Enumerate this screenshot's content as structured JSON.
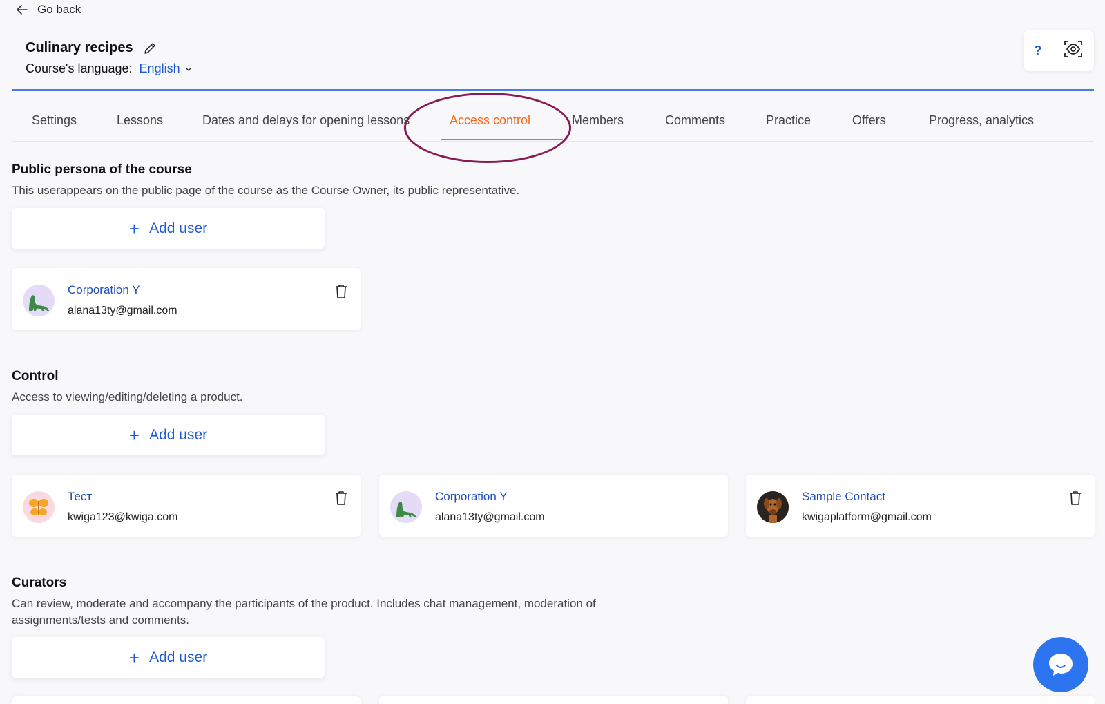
{
  "nav": {
    "go_back": "Go back"
  },
  "course": {
    "title": "Culinary recipes",
    "language_label": "Course's language:",
    "language_value": "English"
  },
  "top_actions": {
    "help": "?"
  },
  "tabs": [
    {
      "label": "Settings"
    },
    {
      "label": "Lessons"
    },
    {
      "label": "Dates and delays for opening lessons"
    },
    {
      "label": "Access control",
      "active": true
    },
    {
      "label": "Members"
    },
    {
      "label": "Comments"
    },
    {
      "label": "Practice"
    },
    {
      "label": "Offers"
    },
    {
      "label": "Progress, analytics"
    }
  ],
  "sections": {
    "public_persona": {
      "title": "Public persona of the course",
      "description": "This userappears on the public page of the course as the Course Owner, its public representative.",
      "add_label": "Add user",
      "users": [
        {
          "name": "Corporation Y",
          "email": "alana13ty@gmail.com",
          "avatar": "dinosaur-avatar"
        }
      ]
    },
    "control": {
      "title": "Control",
      "description": "Access to viewing/editing/deleting a product.",
      "add_label": "Add user",
      "users": [
        {
          "name": "Тест",
          "email": "kwiga123@kwiga.com",
          "avatar": "butterfly-avatar"
        },
        {
          "name": "Corporation Y",
          "email": "alana13ty@gmail.com",
          "avatar": "dinosaur-avatar"
        },
        {
          "name": "Sample Contact",
          "email": "kwigaplatform@gmail.com",
          "avatar": "dog-avatar"
        }
      ]
    },
    "curators": {
      "title": "Curators",
      "description": "Can review, moderate and accompany the participants of the product. Includes chat management, moderation of assignments/tests and comments.",
      "add_label": "Add user"
    }
  },
  "colors": {
    "accent_blue": "#1f5bd8",
    "active_tab": "#f26b1d",
    "highlight_ellipse": "#8c1a52",
    "chat_button": "#2d74f0"
  }
}
